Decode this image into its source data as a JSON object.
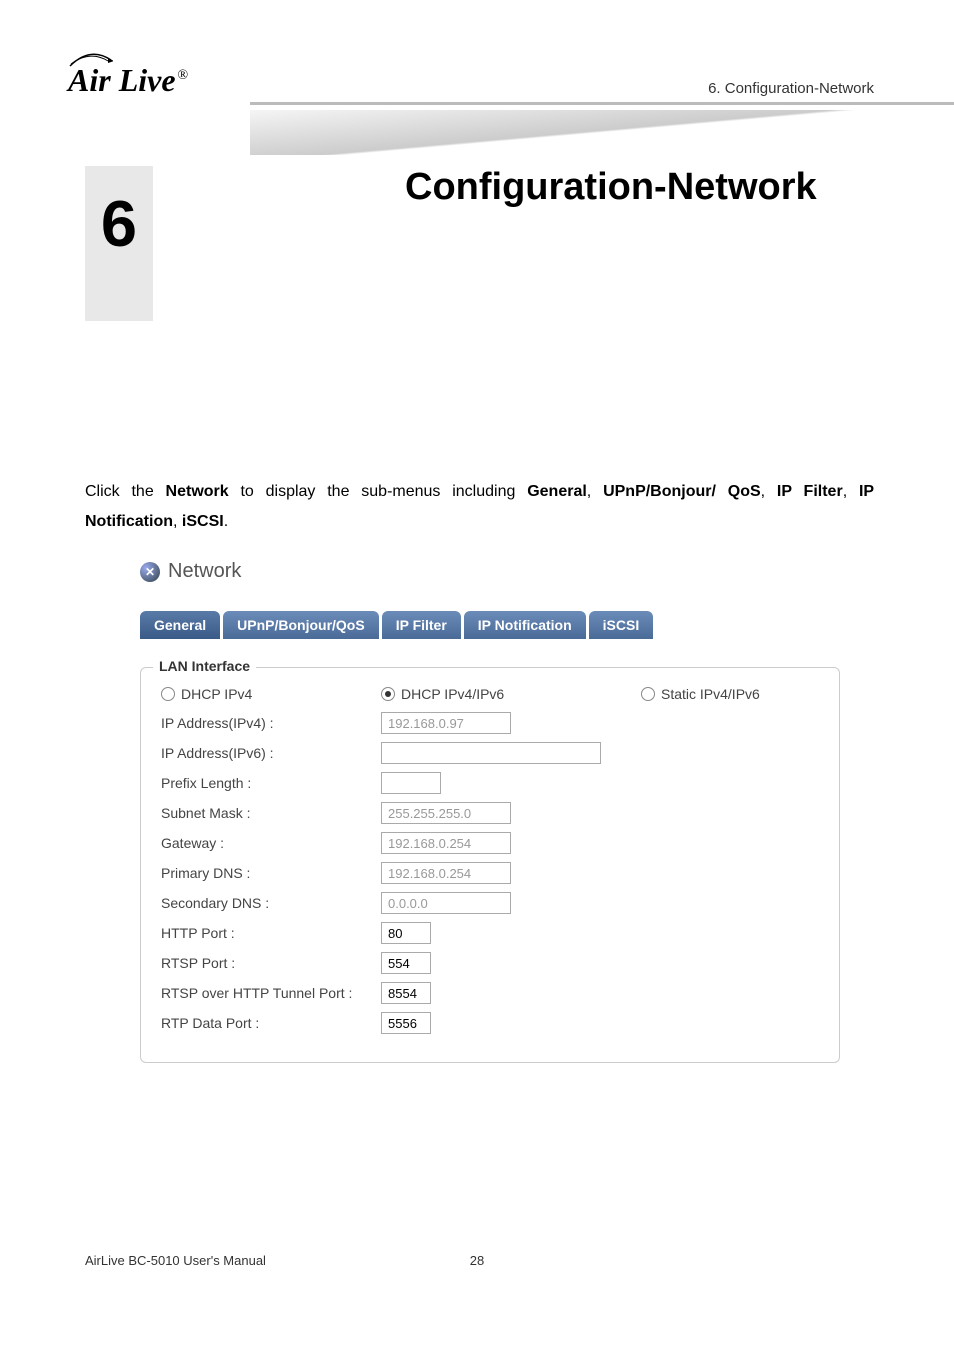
{
  "header": {
    "logo": "Air Live",
    "breadcrumb": "6.  Configuration-Network"
  },
  "chapter": {
    "number": "6",
    "title": "Configuration-Network"
  },
  "intro": {
    "prefix": "Click the ",
    "b1": "Network",
    "mid1": " to display the sub-menus including ",
    "b2": "General",
    "sep1": ", ",
    "b3": "UPnP/Bonjour/ QoS",
    "sep2": ", ",
    "b4": "IP Filter",
    "sep3": ", ",
    "b5": "IP Notification",
    "sep4": ", ",
    "b6": "iSCSI",
    "suffix": "."
  },
  "screenshot": {
    "title": "Network",
    "tabs": {
      "t0": "General",
      "t1": "UPnP/Bonjour/QoS",
      "t2": "IP Filter",
      "t3": "IP Notification",
      "t4": "iSCSI"
    },
    "panel": {
      "legend": "LAN Interface",
      "radios": {
        "r0": "DHCP IPv4",
        "r1": "DHCP IPv4/IPv6",
        "r2": "Static IPv4/IPv6"
      },
      "fields": {
        "ipv4_label": "IP Address(IPv4) :",
        "ipv4_value": "192.168.0.97",
        "ipv6_label": "IP Address(IPv6) :",
        "ipv6_value": "",
        "prefix_label": "Prefix Length :",
        "prefix_value": "",
        "subnet_label": "Subnet Mask :",
        "subnet_value": "255.255.255.0",
        "gateway_label": "Gateway :",
        "gateway_value": "192.168.0.254",
        "pdns_label": "Primary DNS :",
        "pdns_value": "192.168.0.254",
        "sdns_label": "Secondary DNS :",
        "sdns_value": "0.0.0.0",
        "http_label": "HTTP Port :",
        "http_value": "80",
        "rtsp_label": "RTSP Port :",
        "rtsp_value": "554",
        "rtsph_label": "RTSP over HTTP Tunnel Port :",
        "rtsph_value": "8554",
        "rtp_label": "RTP Data Port :",
        "rtp_value": "5556"
      }
    }
  },
  "footer": {
    "left": "AirLive BC-5010 User's Manual",
    "page": "28"
  }
}
